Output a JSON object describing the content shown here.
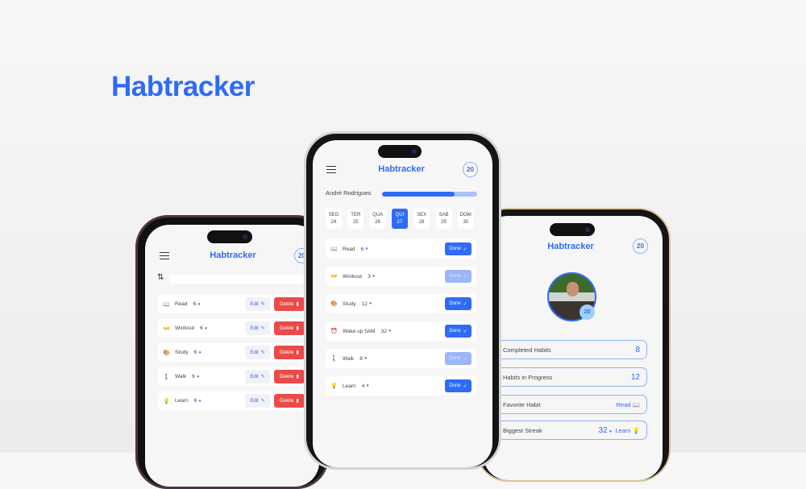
{
  "brand": "Habtracker",
  "left": {
    "title": "Habtracker",
    "badge": "20",
    "edit": "Edit",
    "delete": "Delete",
    "habits": [
      {
        "icon": "📖",
        "name": "Read",
        "count": "6"
      },
      {
        "icon": "👐",
        "name": "Workout",
        "count": "6"
      },
      {
        "icon": "🎨",
        "name": "Study",
        "count": "6"
      },
      {
        "icon": "🚶",
        "name": "Walk",
        "count": "6"
      },
      {
        "icon": "💡",
        "name": "Learn",
        "count": "6"
      }
    ]
  },
  "center": {
    "title": "Habtracker",
    "badge": "20",
    "user": "André Rodrigues",
    "progress": 0.76,
    "done": "Done",
    "days": [
      {
        "d": "SEG",
        "n": "24"
      },
      {
        "d": "TER",
        "n": "25"
      },
      {
        "d": "QUA",
        "n": "26"
      },
      {
        "d": "QUI",
        "n": "27",
        "sel": true
      },
      {
        "d": "SEX",
        "n": "28"
      },
      {
        "d": "SAB",
        "n": "29"
      },
      {
        "d": "DOM",
        "n": "30"
      }
    ],
    "habits": [
      {
        "icon": "📖",
        "name": "Read",
        "count": "6",
        "done": true
      },
      {
        "icon": "👐",
        "name": "Workout",
        "count": "3",
        "done": false
      },
      {
        "icon": "🎨",
        "name": "Study",
        "count": "12",
        "done": true
      },
      {
        "icon": "⏰",
        "name": "Wake up 5AM",
        "count": "32",
        "done": true
      },
      {
        "icon": "🚶",
        "name": "Walk",
        "count": "8",
        "done": false
      },
      {
        "icon": "💡",
        "name": "Learn",
        "count": "4",
        "done": true
      }
    ]
  },
  "right": {
    "title": "Habtracker",
    "badge": "20",
    "avatar_badge": "20",
    "stats": {
      "completed_label": "Completed Habits",
      "completed": "8",
      "progress_label": "Habits in Progress",
      "progress": "12",
      "favorite_label": "Favorite Habit",
      "favorite": "Read",
      "favorite_icon": "📖",
      "streak_label": "Biggest Streak",
      "streak": "32",
      "streak_habit": "Learn",
      "streak_icon": "💡"
    }
  }
}
